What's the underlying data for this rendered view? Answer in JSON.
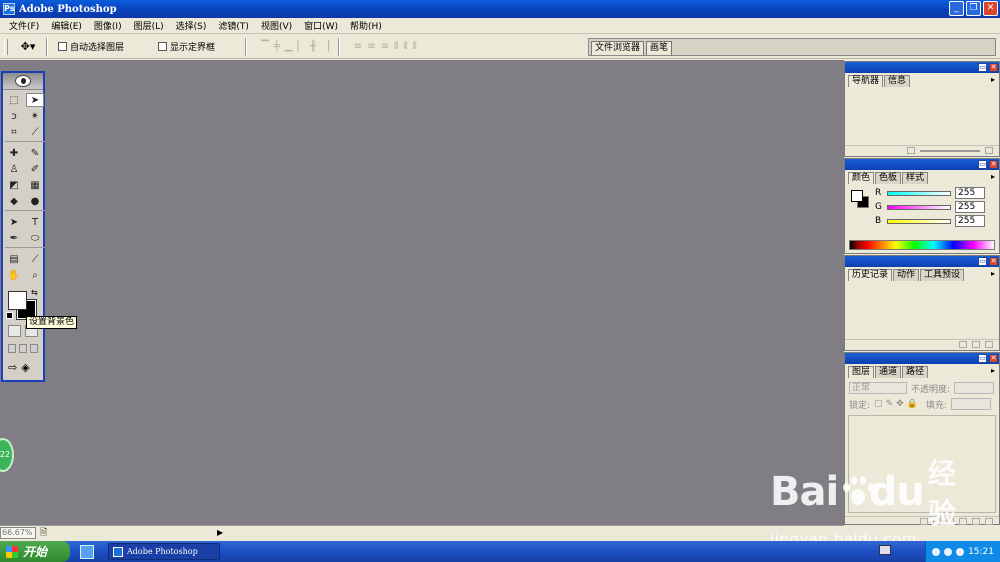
{
  "window": {
    "title": "Adobe Photoshop",
    "controls": [
      "_",
      "❐",
      "✕"
    ]
  },
  "menu": {
    "items": [
      "文件(F)",
      "编辑(E)",
      "图像(I)",
      "图层(L)",
      "选择(S)",
      "滤镜(T)",
      "视图(V)",
      "窗口(W)",
      "帮助(H)"
    ]
  },
  "options": {
    "tool_preset_icon": "move-tool-icon",
    "auto_select_layer": "自动选择图层",
    "show_bounding_box": "显示定界框",
    "auto_select_checked": false,
    "show_bounding_checked": false
  },
  "palette_well": {
    "tabs": [
      "文件浏览器",
      "画笔"
    ]
  },
  "toolbox": {
    "tooltip": "设置背景色",
    "foreground_color": "#ffffff",
    "background_color": "#000000"
  },
  "palettes": {
    "navigator": {
      "tabs": [
        "导航器",
        "信息"
      ]
    },
    "color": {
      "tabs": [
        "颜色",
        "色板",
        "样式"
      ],
      "channels": [
        {
          "label": "R",
          "value": "255",
          "color": "#00ffff"
        },
        {
          "label": "G",
          "value": "255",
          "color": "#ff00ff"
        },
        {
          "label": "B",
          "value": "255",
          "color": "#ffff00"
        }
      ]
    },
    "history": {
      "tabs": [
        "历史记录",
        "动作",
        "工具预设"
      ]
    },
    "layers": {
      "tabs": [
        "图层",
        "通道",
        "路径"
      ],
      "blend_mode": "正常",
      "opacity_label": "不透明度:",
      "lock_label": "锁定:",
      "fill_label": "填充:"
    }
  },
  "status": {
    "zoom": "66.67%"
  },
  "taskbar": {
    "start_label": "开始",
    "task_title": "Adobe Photoshop",
    "clock": "15:21"
  },
  "overlay": {
    "badge_text": "22",
    "watermark_brand": "Bai",
    "watermark_brand2": "du",
    "watermark_jingyan": "经验",
    "watermark_url": "jingyan.baidu.com"
  }
}
